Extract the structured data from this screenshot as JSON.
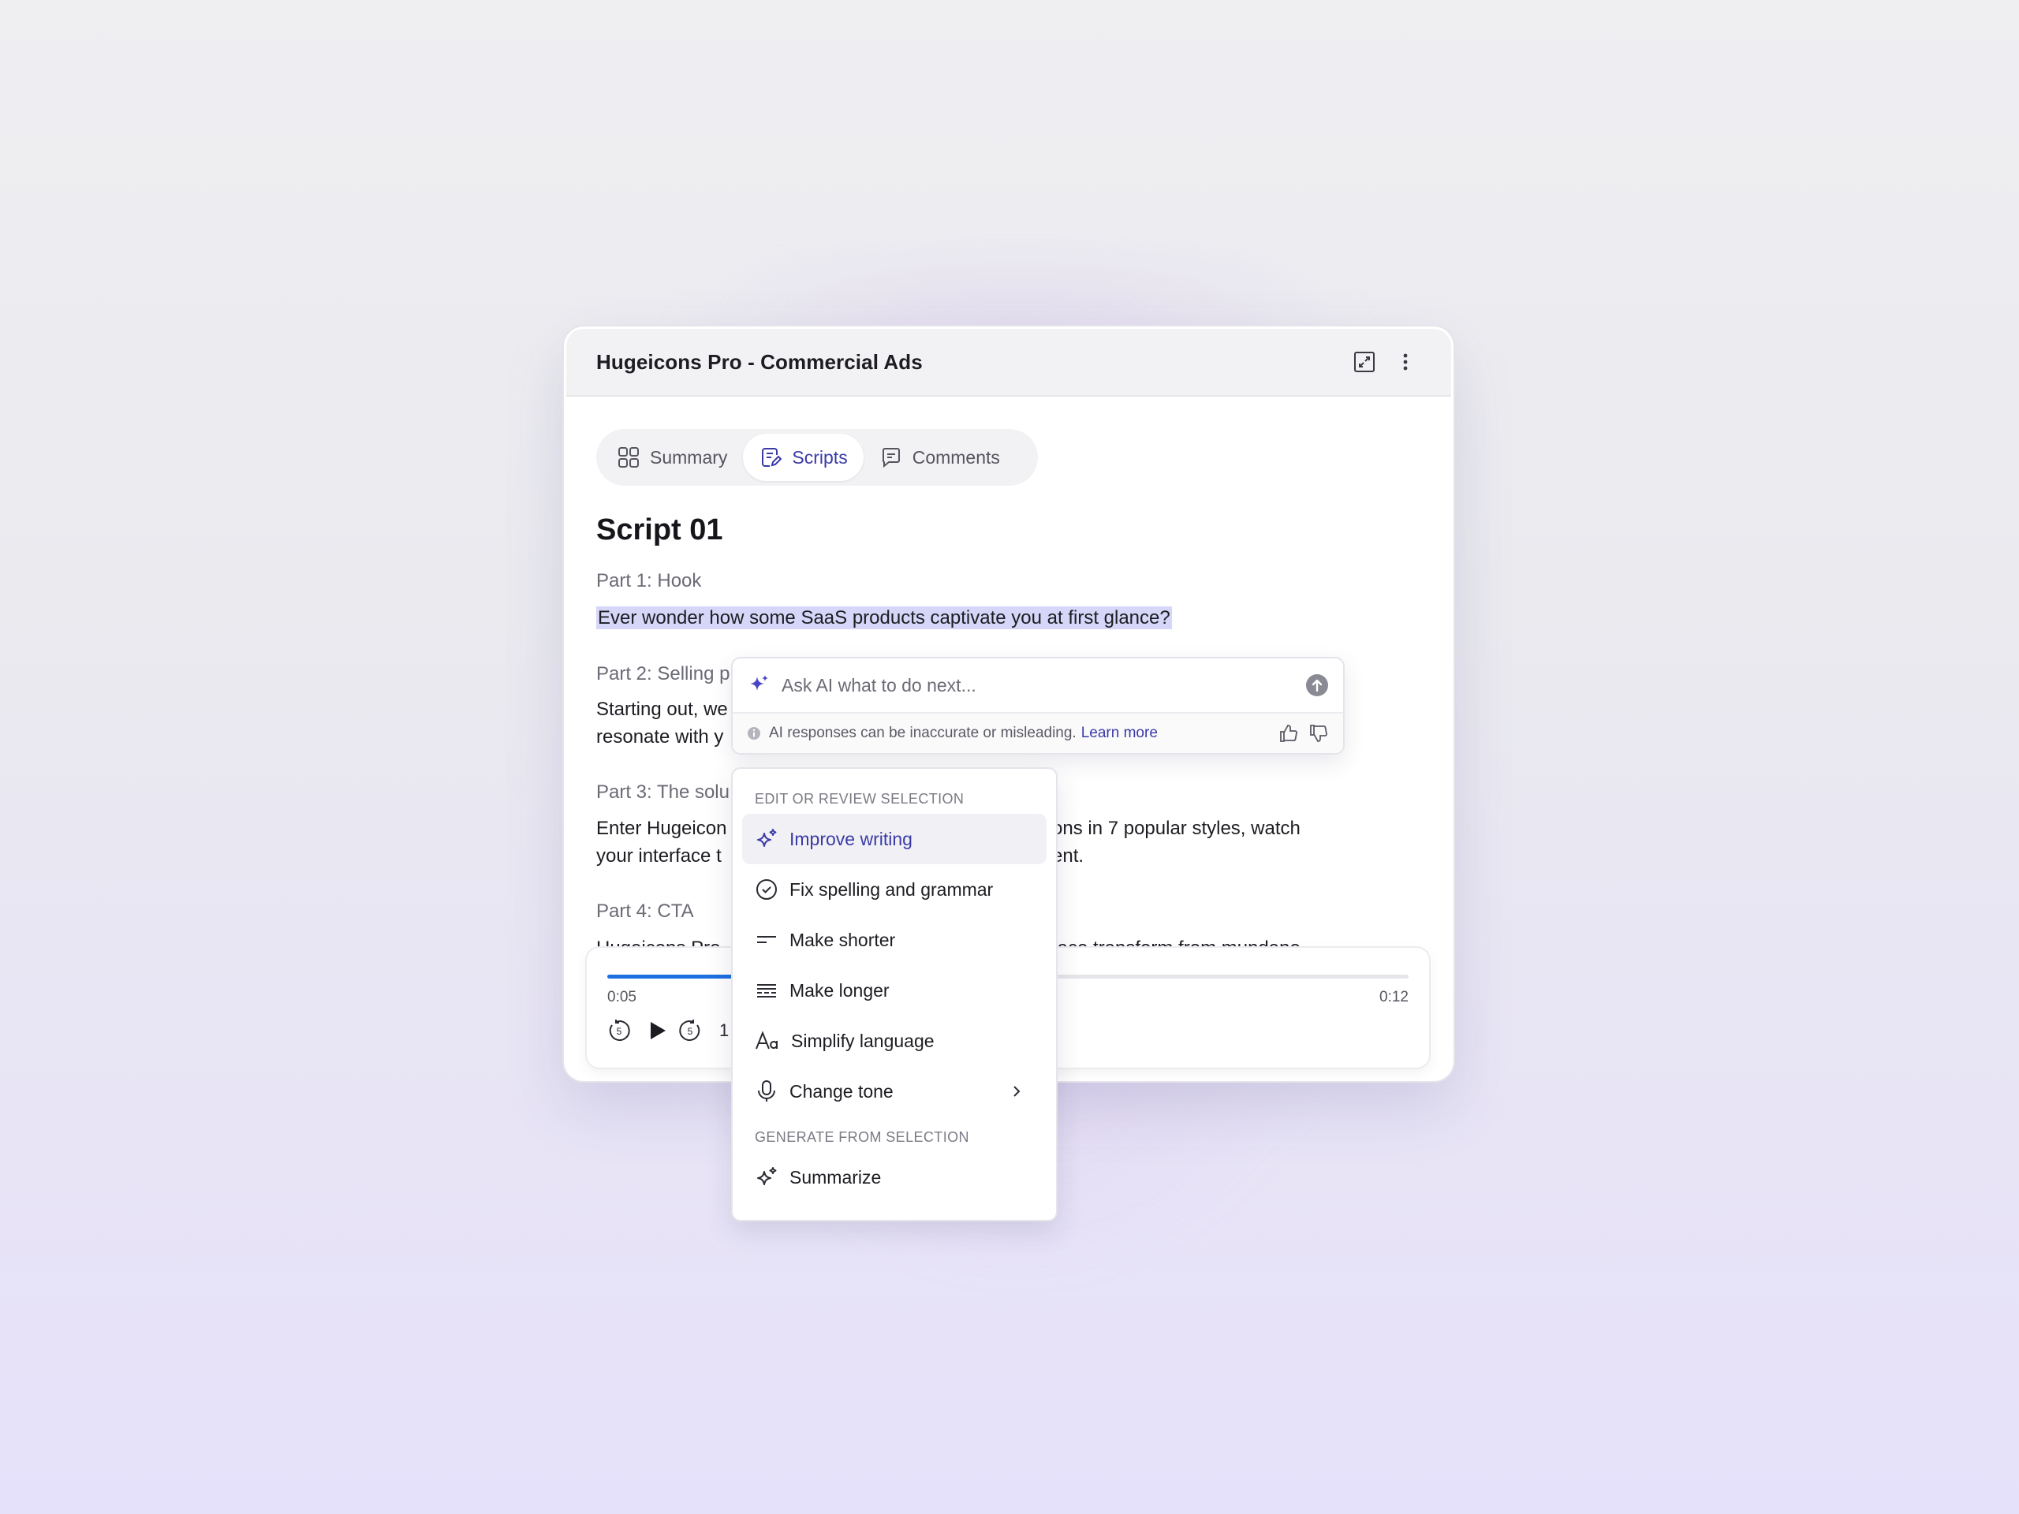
{
  "window": {
    "title": "Hugeicons Pro - Commercial Ads",
    "expand_icon": "expand-icon",
    "more_icon": "more-vertical-icon"
  },
  "tabs": [
    {
      "label": "Summary",
      "icon": "grid-icon"
    },
    {
      "label": "Scripts",
      "icon": "note-edit-icon",
      "active": true
    },
    {
      "label": "Comments",
      "icon": "message-icon"
    }
  ],
  "script": {
    "title": "Script 01",
    "parts": [
      {
        "label": "Part 1: Hook",
        "text": "Ever wonder how some SaaS products captivate you at first glance?"
      },
      {
        "label": "Part 2: Selling p",
        "line1": "Starting out, we",
        "line2": "resonate with y"
      },
      {
        "label": "Part 3: The solu",
        "line1a": "Enter Hugeicon",
        "line1b": "ons in 7 popular styles, watch",
        "line2a": "your interface t",
        "line2b": "ent."
      },
      {
        "label": "Part 4: CTA",
        "line1a": "Hugeicons Pro",
        "line1b": "face transform from mundane"
      }
    ]
  },
  "player": {
    "current_time": "0:05",
    "total_time": "0:12",
    "progress": 0.42,
    "speed": "1"
  },
  "ai_prompt": {
    "placeholder": "Ask AI what to do next...",
    "disclaimer": "AI responses can be inaccurate or misleading.",
    "learn_more": "Learn more"
  },
  "menu": {
    "section1": "EDIT OR REVIEW SELECTION",
    "section2": "GENERATE FROM SELECTION",
    "items": [
      {
        "label": "Improve writing",
        "icon": "sparkle-icon"
      },
      {
        "label": "Fix spelling and grammar",
        "icon": "check-circle-icon"
      },
      {
        "label": "Make shorter",
        "icon": "text-short-icon"
      },
      {
        "label": "Make longer",
        "icon": "text-long-icon"
      },
      {
        "label": "Simplify language",
        "icon": "font-icon"
      },
      {
        "label": "Change tone",
        "icon": "mic-icon"
      },
      {
        "label": "Summarize",
        "icon": "sparkle-icon"
      }
    ]
  },
  "colors": {
    "accent": "#3a3aa8",
    "progress": "#1e6fe0",
    "highlight": "#d6d6f8"
  }
}
